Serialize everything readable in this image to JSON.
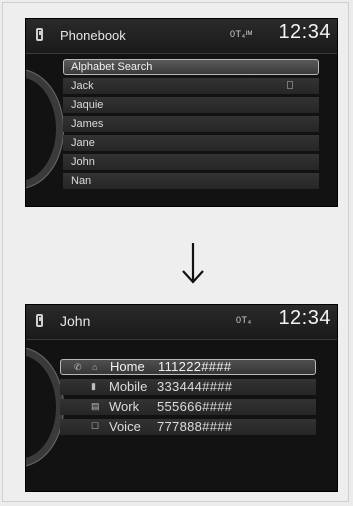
{
  "screen1": {
    "title": "Phonebook",
    "status": "0T₄ᴵᴹ",
    "clock": "12:34",
    "items": [
      {
        "label": "Alphabet Search"
      },
      {
        "label": "Jack"
      },
      {
        "label": "Jaquie"
      },
      {
        "label": "James"
      },
      {
        "label": "Jane"
      },
      {
        "label": "John"
      },
      {
        "label": "Nan"
      }
    ]
  },
  "screen2": {
    "title": "John",
    "status": "0T₄",
    "clock": "12:34",
    "entries": [
      {
        "label": "Home",
        "number": "111222####",
        "icon": "home-icon"
      },
      {
        "label": "Mobile",
        "number": "333444####",
        "icon": "mobile-icon"
      },
      {
        "label": "Work",
        "number": "555666####",
        "icon": "work-icon"
      },
      {
        "label": "Voice",
        "number": "777888####",
        "icon": "voice-icon"
      }
    ]
  },
  "arrow": {
    "icon": "down-arrow-icon"
  }
}
